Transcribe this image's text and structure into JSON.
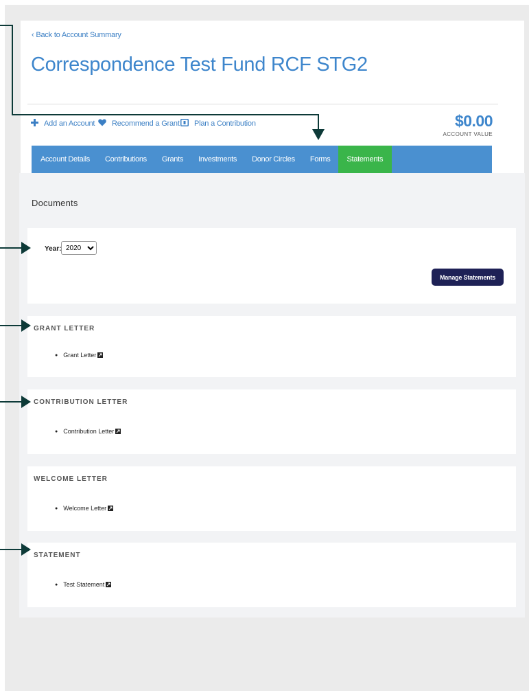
{
  "back_link": "‹ Back to Account Summary",
  "fund_title": "Correspondence Test Fund RCF STG2",
  "actions": [
    {
      "label": "Add an Account",
      "icon": "plus-icon"
    },
    {
      "label": "Recommend a Grant",
      "icon": "heart-icon"
    },
    {
      "label": "Plan a Contribution",
      "icon": "calendar-icon"
    }
  ],
  "account_value": {
    "amount": "$0.00",
    "label": "ACCOUNT VALUE"
  },
  "tabs": [
    {
      "label": "Account Details",
      "active": false
    },
    {
      "label": "Contributions",
      "active": false
    },
    {
      "label": "Grants",
      "active": false
    },
    {
      "label": "Investments",
      "active": false
    },
    {
      "label": "Donor Circles",
      "active": false
    },
    {
      "label": "Forms",
      "active": false
    },
    {
      "label": "Statements",
      "active": true
    }
  ],
  "documents_title": "Documents",
  "year_filter": {
    "label": "Year:",
    "value": "2020"
  },
  "manage_button": "Manage Statements",
  "sections": [
    {
      "heading": "GRANT LETTER",
      "item": "Grant Letter"
    },
    {
      "heading": "CONTRIBUTION LETTER",
      "item": "Contribution Letter"
    },
    {
      "heading": "WELCOME LETTER",
      "item": "Welcome Letter"
    },
    {
      "heading": "STATEMENT",
      "item": "Test Statement"
    }
  ],
  "colors": {
    "title_blue": "#3e86cc",
    "tab_bar": "#4a90d0",
    "tab_active": "#3ab54a",
    "button_navy": "#1e2156",
    "annotation_arrow": "#0d3a38"
  }
}
